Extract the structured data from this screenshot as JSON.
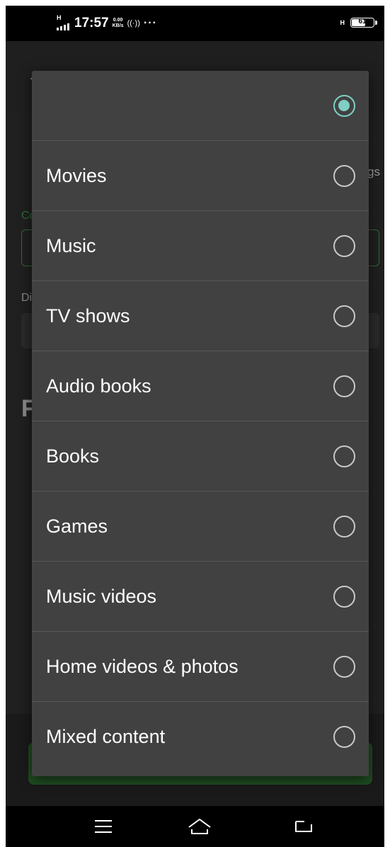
{
  "status_bar": {
    "network_type": "H",
    "time": "17:57",
    "speed_value": "0.00",
    "speed_unit": "KB/s",
    "hotspot_icon": "hotspot-icon",
    "more": "···",
    "battery_network": "H",
    "battery_level": "61"
  },
  "background_screen": {
    "title": "New Library",
    "settings_label": "gs",
    "content_type_label": "Co",
    "display_name_label": "Di",
    "folders_heading": "F"
  },
  "dialog": {
    "selected_index": 0,
    "accent_color": "#7fcfc4",
    "options": [
      {
        "label": ""
      },
      {
        "label": "Movies"
      },
      {
        "label": "Music"
      },
      {
        "label": "TV shows"
      },
      {
        "label": "Audio books"
      },
      {
        "label": "Books"
      },
      {
        "label": "Games"
      },
      {
        "label": "Music videos"
      },
      {
        "label": "Home videos & photos"
      },
      {
        "label": "Mixed content"
      }
    ]
  },
  "nav_bar": {
    "menu_icon": "menu-icon",
    "home_icon": "home-icon",
    "back_icon": "back-icon"
  }
}
